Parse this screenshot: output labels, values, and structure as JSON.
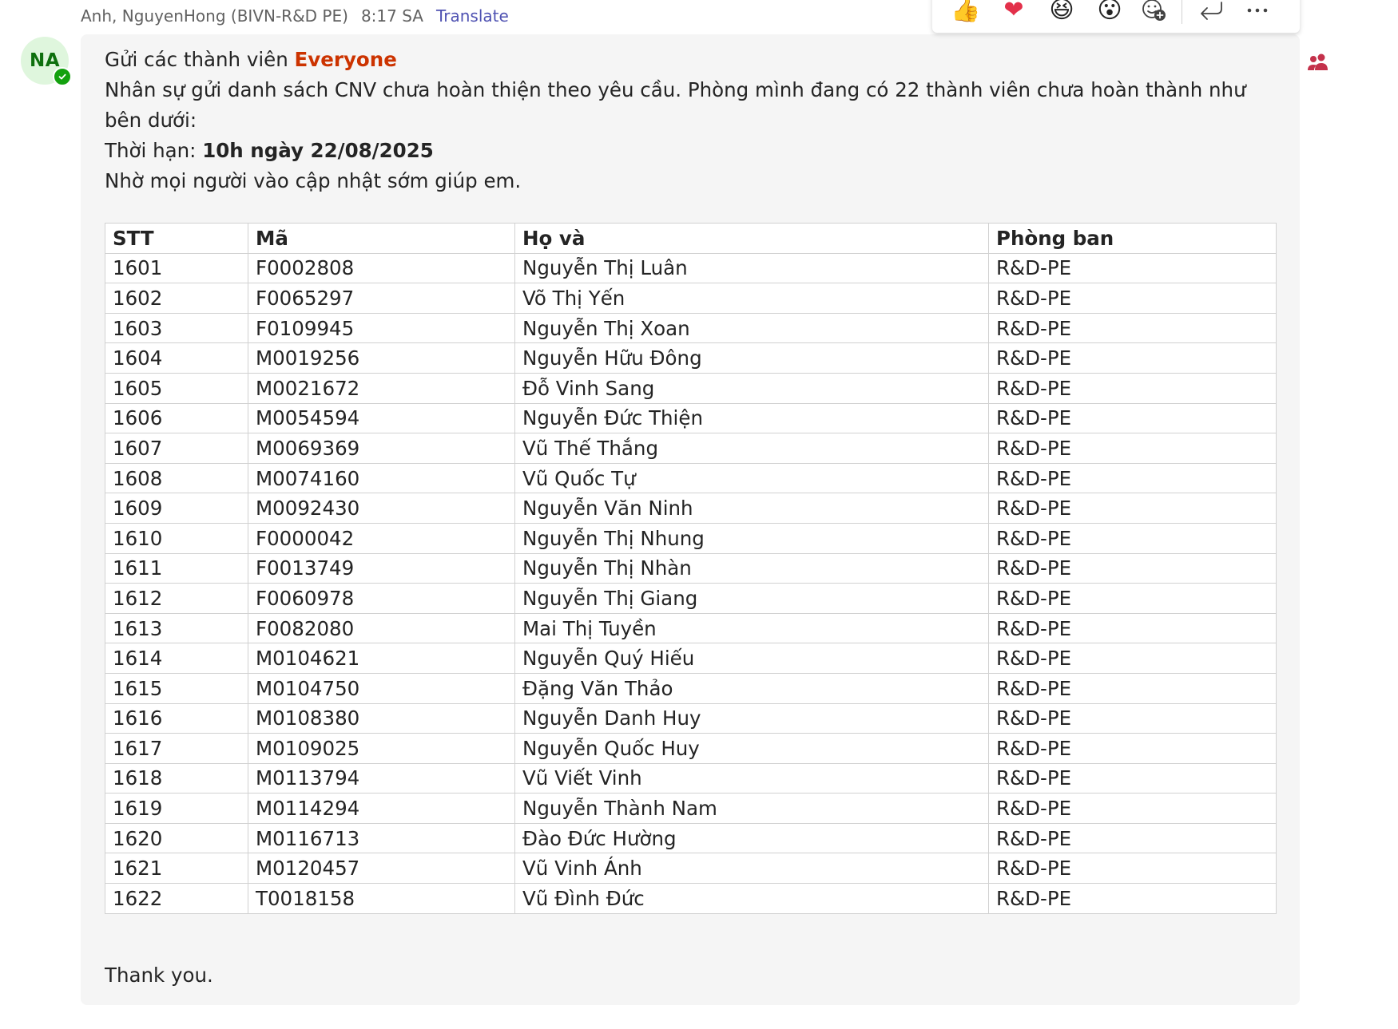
{
  "message": {
    "sender": "Anh, NguyenHong (BIVN-R&D PE)",
    "time": "8:17 SA",
    "translate_label": "Translate",
    "avatar_initials": "NA",
    "greeting_prefix": "Gửi các thành viên",
    "mention": "Everyone",
    "line2": "Nhân sự gửi danh sách CNV chưa hoàn thiện theo yêu cầu. Phòng mình đang có 22 thành viên chưa hoàn thành như bên dưới:",
    "deadline_label": "Thời hạn:",
    "deadline_value": "10h ngày 22/08/2025",
    "line4": "Nhờ mọi người vào cập nhật sớm giúp em.",
    "closing": "Thank you."
  },
  "table": {
    "headers": [
      "STT",
      "Mã",
      "Họ và",
      "Phòng ban"
    ],
    "rows": [
      [
        "1601",
        "F0002808",
        "Nguyễn Thị Luân",
        "R&D-PE"
      ],
      [
        "1602",
        "F0065297",
        "Võ Thị Yến",
        "R&D-PE"
      ],
      [
        "1603",
        "F0109945",
        "Nguyễn Thị Xoan",
        "R&D-PE"
      ],
      [
        "1604",
        "M0019256",
        "Nguyễn Hữu Đông",
        "R&D-PE"
      ],
      [
        "1605",
        "M0021672",
        "Đỗ Vinh Sang",
        "R&D-PE"
      ],
      [
        "1606",
        "M0054594",
        "Nguyễn Đức Thiện",
        "R&D-PE"
      ],
      [
        "1607",
        "M0069369",
        "Vũ Thế Thắng",
        "R&D-PE"
      ],
      [
        "1608",
        "M0074160",
        "Vũ Quốc Tự",
        "R&D-PE"
      ],
      [
        "1609",
        "M0092430",
        "Nguyễn Văn Ninh",
        "R&D-PE"
      ],
      [
        "1610",
        "F0000042",
        "Nguyễn Thị Nhung",
        "R&D-PE"
      ],
      [
        "1611",
        "F0013749",
        "Nguyễn Thị Nhàn",
        "R&D-PE"
      ],
      [
        "1612",
        "F0060978",
        "Nguyễn Thị Giang",
        "R&D-PE"
      ],
      [
        "1613",
        "F0082080",
        "Mai Thị Tuyền",
        "R&D-PE"
      ],
      [
        "1614",
        "M0104621",
        "Nguyễn Quý Hiếu",
        "R&D-PE"
      ],
      [
        "1615",
        "M0104750",
        "Đặng Văn Thảo",
        "R&D-PE"
      ],
      [
        "1616",
        "M0108380",
        "Nguyễn Danh Huy",
        "R&D-PE"
      ],
      [
        "1617",
        "M0109025",
        "Nguyễn Quốc Huy",
        "R&D-PE"
      ],
      [
        "1618",
        "M0113794",
        "Vũ Viết Vinh",
        "R&D-PE"
      ],
      [
        "1619",
        "M0114294",
        "Nguyễn Thành Nam",
        "R&D-PE"
      ],
      [
        "1620",
        "M0116713",
        "Đào Đức Hường",
        "R&D-PE"
      ],
      [
        "1621",
        "M0120457",
        "Vũ Vinh Ánh",
        "R&D-PE"
      ],
      [
        "1622",
        "T0018158",
        "Vũ Đình Đức",
        "R&D-PE"
      ]
    ]
  },
  "reactions": [
    {
      "name": "like-reaction",
      "glyph": "👍"
    },
    {
      "name": "heart-reaction",
      "glyph": "❤"
    },
    {
      "name": "laugh-reaction",
      "glyph": "😆"
    },
    {
      "name": "surprised-reaction",
      "glyph": "😮"
    }
  ],
  "colors": {
    "mention": "#cc3300",
    "translate_link": "#4f52b2",
    "bubble_bg": "#f5f5f5",
    "avatar_bg": "#dff6dd",
    "avatar_fg": "#0e700e",
    "presence": "#13a10e",
    "group_icon": "#c4314b"
  },
  "icons": {
    "add_reaction": "add-reaction-icon",
    "reply": "reply-icon",
    "more": "more-options-icon",
    "presence": "checkmark-icon",
    "group": "group-mention-icon"
  }
}
